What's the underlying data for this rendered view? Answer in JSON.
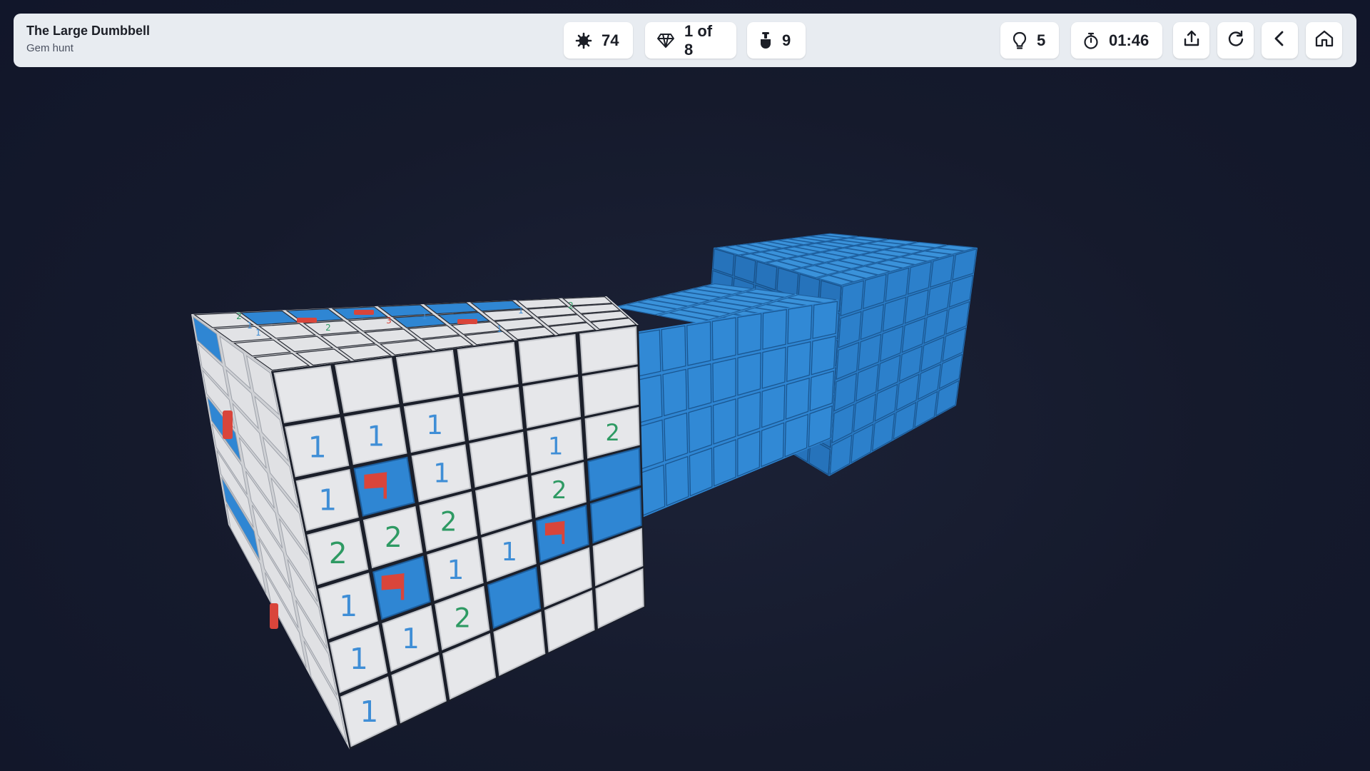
{
  "puzzle": {
    "title": "The Large Dumbbell",
    "mode": "Gem hunt"
  },
  "stats": {
    "mines": "74",
    "gems": "1 of 8",
    "digs": "9",
    "hints": "5",
    "timer": "01:46"
  },
  "icons": {
    "mines": "mine-icon",
    "gems": "gem-icon",
    "digs": "shovel-icon",
    "hints": "lightbulb-icon",
    "timer": "stopwatch-icon",
    "share": "share-icon",
    "restart": "restart-icon",
    "back": "chevron-left-icon",
    "home": "home-icon"
  },
  "colors": {
    "revealed_tile": "#e6e7ea",
    "hidden_tile": "#2f86d3",
    "flag": "#d9453b",
    "number_1": "#3f8ed6",
    "number_2": "#2e9a63",
    "number_3": "#d9453b"
  },
  "board": {
    "front_face": [
      [
        "",
        "",
        "",
        "",
        "",
        ""
      ],
      [
        "1",
        "1",
        "1",
        "",
        "",
        ""
      ],
      [
        "1",
        "flag",
        "1",
        "",
        "1",
        "2"
      ],
      [
        "2",
        "2",
        "2",
        "",
        "2",
        "hidden"
      ],
      [
        "1",
        "flag",
        "1",
        "1",
        "flag",
        "hidden"
      ],
      [
        "1",
        "1",
        "2",
        "hidden",
        "",
        ""
      ],
      [
        "1",
        "",
        "",
        "",
        "",
        ""
      ]
    ],
    "top_face_numbers": [
      "2",
      "1",
      "1",
      "2",
      "3",
      "1",
      "1",
      "2",
      "1"
    ]
  }
}
